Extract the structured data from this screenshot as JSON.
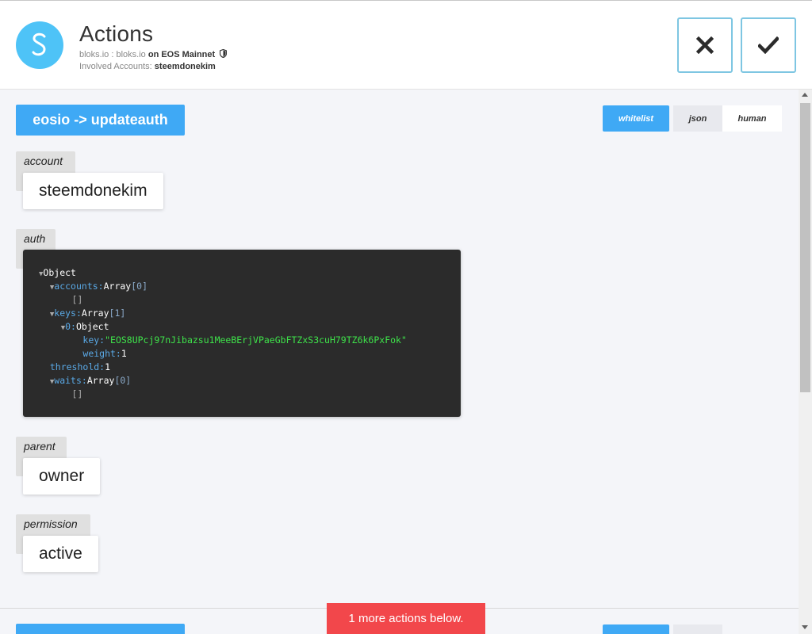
{
  "header": {
    "title": "Actions",
    "origin_app": "bloks.io",
    "origin_domain": "bloks.io",
    "origin_on": "on EOS Mainnet",
    "involved_label": "Involved Accounts:",
    "involved_accounts": "steemdonekim",
    "separator": ":"
  },
  "icons": {
    "logo": "scatter-logo-icon",
    "close": "close-icon",
    "confirm": "checkmark-icon",
    "verified": "shield-icon"
  },
  "action": {
    "title": "eosio -> updateauth",
    "views": [
      "whitelist",
      "json",
      "human"
    ],
    "active_view": "whitelist"
  },
  "fields": {
    "account": {
      "label": "account",
      "value": "steemdonekim"
    },
    "auth": {
      "label": "auth"
    },
    "parent": {
      "label": "parent",
      "value": "owner"
    },
    "permission": {
      "label": "permission",
      "value": "active"
    }
  },
  "auth_tree": {
    "root_type": "Object",
    "accounts_key": "accounts:",
    "accounts_type": "Array",
    "accounts_count": "[0]",
    "accounts_empty": "[]",
    "keys_key": "keys:",
    "keys_type": "Array",
    "keys_count": "[1]",
    "key0_index": "0:",
    "key0_type": "Object",
    "key_key": "key:",
    "key_value": "\"EOS8UPcj97nJibazsu1MeeBErjVPaeGbFTZxS3cuH79TZ6k6PxFok\"",
    "weight_key": "weight:",
    "weight_value": "1",
    "threshold_key": "threshold:",
    "threshold_value": "1",
    "waits_key": "waits:",
    "waits_type": "Array",
    "waits_count": "[0]",
    "waits_empty": "[]"
  },
  "footer": {
    "more_actions": "1 more actions below."
  },
  "colors": {
    "primary": "#3fa9f5",
    "logo": "#4ec3f7",
    "danger": "#f2474b",
    "json_bg": "#2b2b2b",
    "json_key": "#5aa9e6",
    "json_string": "#3ee34a"
  }
}
